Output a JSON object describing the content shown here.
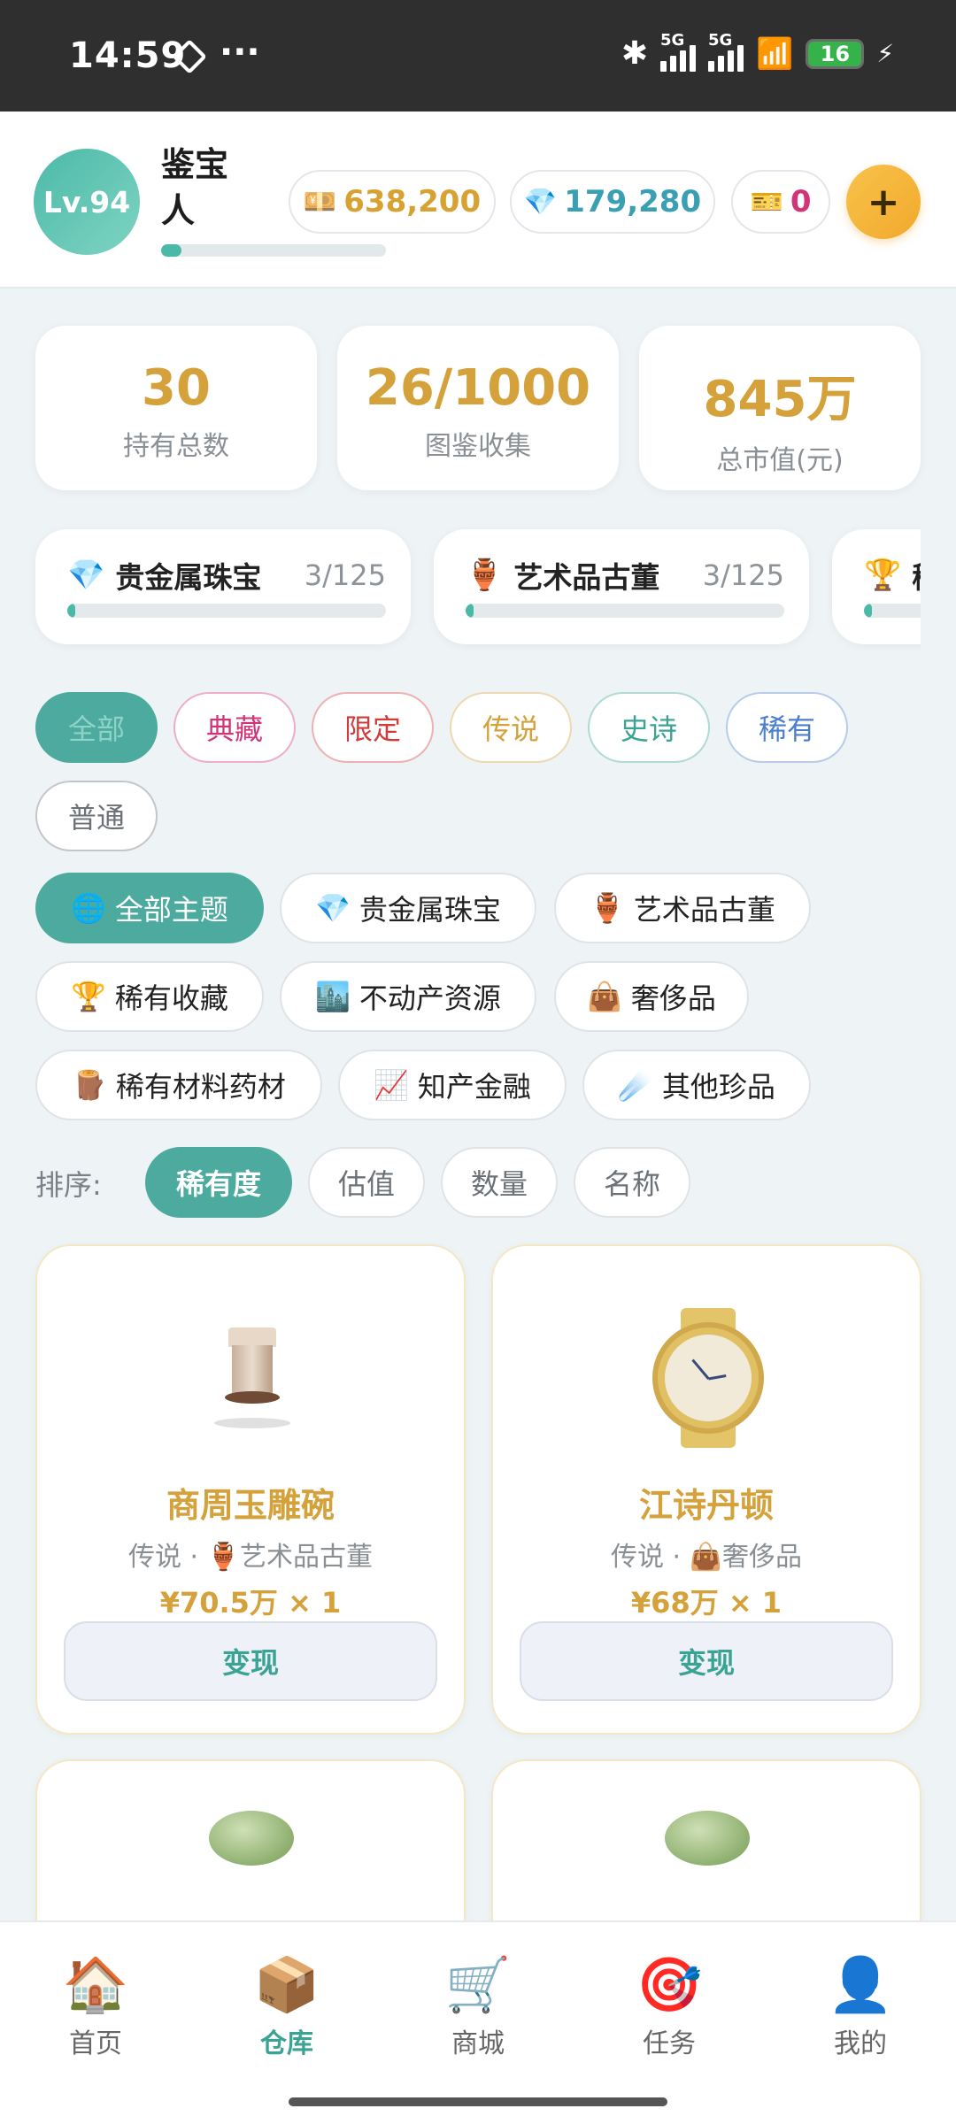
{
  "status": {
    "time": "14:59",
    "network1": "5G",
    "network2": "5G",
    "battery": "16"
  },
  "header": {
    "level": "Lv.94",
    "username": "鉴宝人",
    "xp_progress": 0.09,
    "gold_icon": "💴",
    "gold": "638,200",
    "gem_icon": "💎",
    "gems": "179,280",
    "ticket_icon": "🎫",
    "tickets": "0",
    "plus_label": "+"
  },
  "stats": [
    {
      "value": "30",
      "label": "持有总数"
    },
    {
      "value": "26/1000",
      "label": "图鉴收集"
    },
    {
      "value": "845万",
      "label": "总市值(元)"
    }
  ],
  "theme_cards": [
    {
      "icon": "💎",
      "name": "贵金属珠宝",
      "count": "3/125",
      "progress": 0.024
    },
    {
      "icon": "🏺",
      "name": "艺术品古董",
      "count": "3/125",
      "progress": 0.024
    },
    {
      "icon": "🏆",
      "name": "稀",
      "count": "",
      "progress": 0.024
    }
  ],
  "rarity_filters": [
    {
      "label": "全部",
      "color": "#ffffff"
    },
    {
      "label": "典藏",
      "color": "#d0357a"
    },
    {
      "label": "限定",
      "color": "#d23b3b"
    },
    {
      "label": "传说",
      "color": "#d4a13a"
    },
    {
      "label": "史诗",
      "color": "#3aa394"
    },
    {
      "label": "稀有",
      "color": "#4a7fd0"
    },
    {
      "label": "普通",
      "color": "#6b7177"
    }
  ],
  "theme_filters": [
    {
      "icon": "🌐",
      "label": "全部主题"
    },
    {
      "icon": "💎",
      "label": "贵金属珠宝"
    },
    {
      "icon": "🏺",
      "label": "艺术品古董"
    },
    {
      "icon": "🏆",
      "label": "稀有收藏"
    },
    {
      "icon": "🏙️",
      "label": "不动产资源"
    },
    {
      "icon": "👜",
      "label": "奢侈品"
    },
    {
      "icon": "🪵",
      "label": "稀有材料药材"
    },
    {
      "icon": "📈",
      "label": "知产金融"
    },
    {
      "icon": "☄️",
      "label": "其他珍品"
    }
  ],
  "sort": {
    "label": "排序:",
    "options": [
      "稀有度",
      "估值",
      "数量",
      "名称"
    ]
  },
  "items": [
    {
      "name": "商周玉雕碗",
      "rarity": "传说",
      "icon": "🏺",
      "category": "艺术品古董",
      "price": "¥70.5万 × 1",
      "action": "变现"
    },
    {
      "name": "江诗丹顿",
      "rarity": "传说",
      "icon": "👜",
      "category": "奢侈品",
      "price": "¥68万 × 1",
      "action": "变现"
    }
  ],
  "nav": [
    {
      "icon": "🏠",
      "label": "首页"
    },
    {
      "icon": "📦",
      "label": "仓库"
    },
    {
      "icon": "🛒",
      "label": "商城"
    },
    {
      "icon": "🎯",
      "label": "任务"
    },
    {
      "icon": "👤",
      "label": "我的"
    }
  ]
}
